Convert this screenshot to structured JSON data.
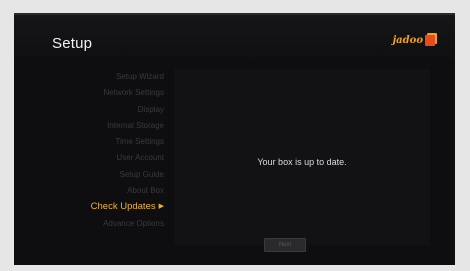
{
  "header": {
    "title": "Setup",
    "logo_text": "jadoo"
  },
  "sidebar": {
    "items": [
      {
        "label": "Setup Wizard"
      },
      {
        "label": "Network Settings"
      },
      {
        "label": "Display"
      },
      {
        "label": "Internal Storage"
      },
      {
        "label": "Time Settings"
      },
      {
        "label": "User Account"
      },
      {
        "label": "Setup Guide"
      },
      {
        "label": "About Box"
      },
      {
        "label": "Check Updates",
        "active": true
      },
      {
        "label": "Advance Options"
      }
    ]
  },
  "main": {
    "status_text": "Your box is up to date.",
    "next_button_label": "Next"
  },
  "colors": {
    "accent": "#f0b429",
    "background": "#0e0e10"
  }
}
